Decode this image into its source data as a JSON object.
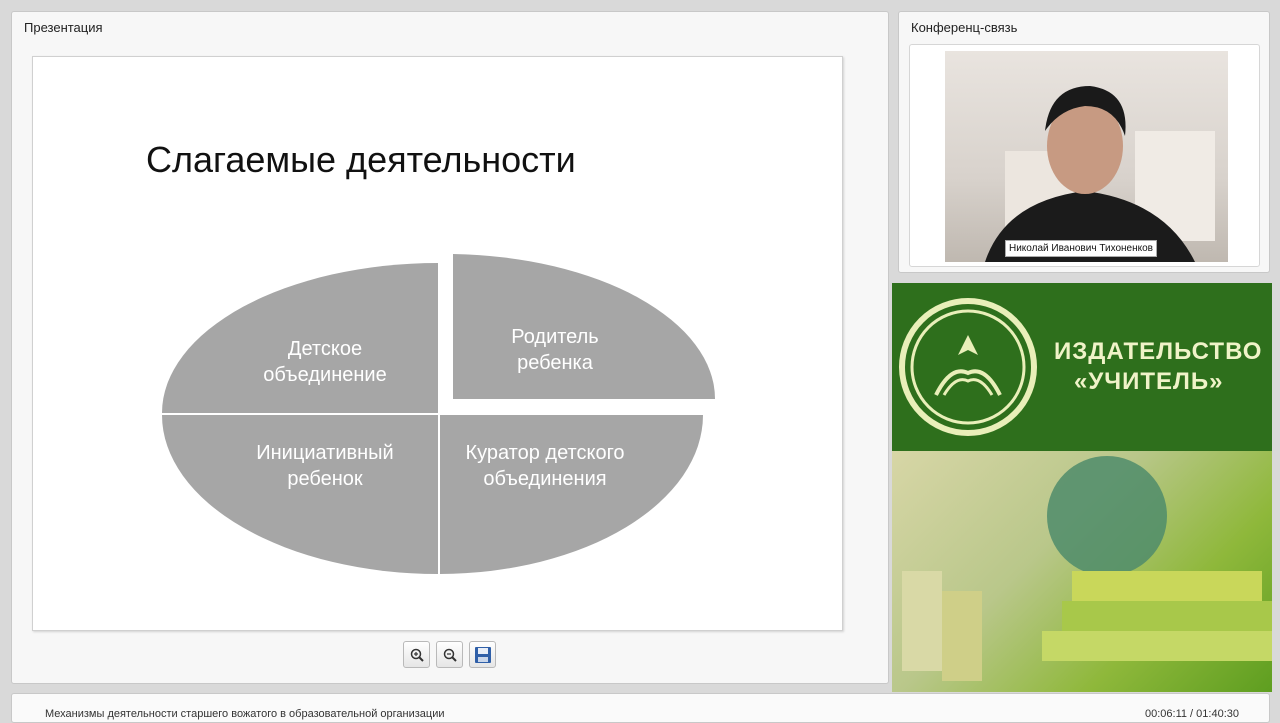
{
  "presentation": {
    "title": "Презентация",
    "slide": {
      "heading": "Слагаемые деятельности",
      "segments": [
        {
          "line1": "Детское",
          "line2": "объединение"
        },
        {
          "line1": "Родитель",
          "line2": "ребенка"
        },
        {
          "line1": "Инициативный",
          "line2": "ребенок"
        },
        {
          "line1": "Куратор детского",
          "line2": "объединения"
        }
      ],
      "segment_color": "#a6a6a6"
    },
    "toolbar": {
      "zoom_in_icon": "zoom-in-icon",
      "zoom_out_icon": "zoom-out-icon",
      "save_icon": "save-icon"
    }
  },
  "conference": {
    "title": "Конференц-связь",
    "speaker_name": "Николай Иванович Тихоненков"
  },
  "banner": {
    "line1": "ИЗДАТЕЛЬСТВО",
    "line2": "«УЧИТЕЛЬ»",
    "brand_color": "#2e6f1c"
  },
  "footer": {
    "course_title": "Механизмы деятельности старшего вожатого в образовательной организации",
    "timecode": "00:06:11 / 01:40:30"
  }
}
